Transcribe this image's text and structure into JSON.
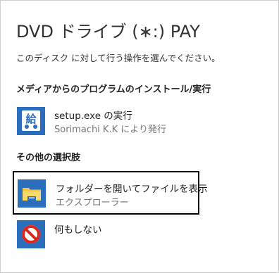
{
  "dialog": {
    "title": "DVD ドライブ (∗:) PAY",
    "prompt": "このディスク に対して行う操作を選んでください。"
  },
  "sections": [
    {
      "heading": "メディアからのプログラムのインストール/実行",
      "options": [
        {
          "main": "setup.exe の実行",
          "sub": "Sorimachi K.K により発行",
          "icon": "installer-app-icon"
        }
      ]
    },
    {
      "heading": "その他の選択肢",
      "options": [
        {
          "main": "フォルダーを開いてファイルを表示",
          "sub": "エクスプローラー",
          "icon": "folder-icon",
          "selected": true
        },
        {
          "main": "何もしない",
          "icon": "prohibited-icon"
        }
      ]
    }
  ],
  "colors": {
    "tile_blue": "#2a6ebc",
    "selection_border": "#000000",
    "prohibit_red": "#e0261b"
  },
  "app_icon_glyph": "給"
}
